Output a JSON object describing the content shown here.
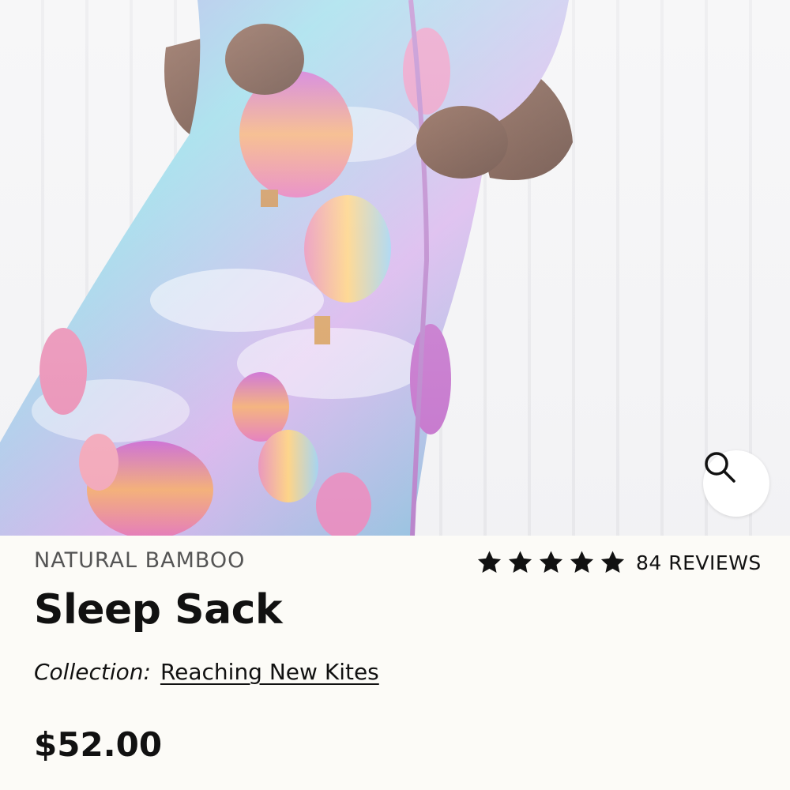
{
  "product": {
    "image_alt": "Baby wearing sleep sack with hot air balloon and kite print",
    "material": "NATURAL BAMBOO",
    "title": "Sleep Sack",
    "rating": 5,
    "reviews_label": "84 REVIEWS",
    "collection_label": "Collection:",
    "collection_name": "Reaching New Kites",
    "price": "$52.00"
  },
  "icons": {
    "zoom": "magnifier-icon",
    "star": "star-icon"
  },
  "colors": {
    "text": "#111111",
    "muted": "#555555",
    "background": "#fcfbf7"
  }
}
